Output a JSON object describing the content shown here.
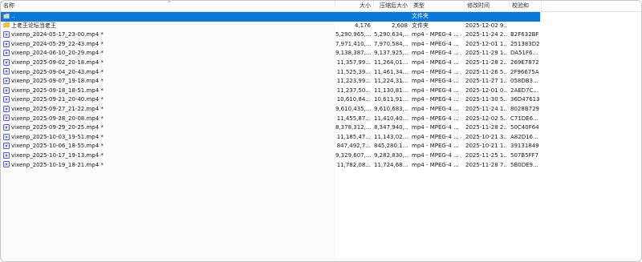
{
  "header": {
    "name": "名称",
    "size": "大小",
    "packed": "压缩后大小",
    "type": "类型",
    "modified": "修改时间",
    "crc": "校验和"
  },
  "rows": [
    {
      "name": "..",
      "size": "",
      "packed": "",
      "type": "文件夹",
      "modified": "",
      "crc": "",
      "icon": "parent-folder-icon",
      "selected": true
    },
    {
      "name": "上老王论坛当老王",
      "size": "4,176",
      "packed": "2,608",
      "type": "文件夹",
      "modified": "2025-12-02 9...",
      "crc": "",
      "icon": "folder-icon"
    },
    {
      "name": "vixenp_2024-05-17_23-00.mp4 *",
      "size": "5,290,965,...",
      "packed": "5,290,634,...",
      "type": "mp4 - MPEG-4 ...",
      "modified": "2025-11-24 2...",
      "crc": "B2F632BF",
      "icon": "video-file-icon"
    },
    {
      "name": "vixenp_2024-05-29_22-43.mp4 *",
      "size": "7,971,410,...",
      "packed": "7,970,584,...",
      "type": "mp4 - MPEG-4 ...",
      "modified": "2025-12-01 1...",
      "crc": "251383D2",
      "icon": "video-file-icon"
    },
    {
      "name": "vixenp_2024-06-10_20-29.mp4 *",
      "size": "9,138,387,...",
      "packed": "9,137,925,...",
      "type": "mp4 - MPEG-4 ...",
      "modified": "2025-11-29 1...",
      "crc": "DA51F6...",
      "icon": "video-file-icon"
    },
    {
      "name": "vixenp_2025-09-02_20-18.mp4 *",
      "size": "11,357,99...",
      "packed": "11,264,01...",
      "type": "mp4 - MPEG-4 ...",
      "modified": "2025-11-28 2...",
      "crc": "269E7872",
      "icon": "video-file-icon"
    },
    {
      "name": "vixenp_2025-09-04_20-43.mp4 *",
      "size": "11,525,39...",
      "packed": "11,461,34...",
      "type": "mp4 - MPEG-4 ...",
      "modified": "2025-11-26 5...",
      "crc": "2F96675A",
      "icon": "video-file-icon"
    },
    {
      "name": "vixenp_2025-09-07_19-18.mp4 *",
      "size": "11,223,99...",
      "packed": "11,224,31...",
      "type": "mp4 - MPEG-4 ...",
      "modified": "2025-11-27 1...",
      "crc": "058DB3...",
      "icon": "video-file-icon"
    },
    {
      "name": "vixenp_2025-09-18_18-51.mp4 *",
      "size": "11,237,50...",
      "packed": "11,130,81...",
      "type": "mp4 - MPEG-4 ...",
      "modified": "2025-12-01 0...",
      "crc": "2AED7C...",
      "icon": "video-file-icon"
    },
    {
      "name": "vixenp_2025-09-21_20-40.mp4 *",
      "size": "10,610,84...",
      "packed": "10,611,91...",
      "type": "mp4 - MPEG-4 ...",
      "modified": "2025-11-30 5...",
      "crc": "36D47613",
      "icon": "video-file-icon"
    },
    {
      "name": "vixenp_2025-09-27_21-22.mp4 *",
      "size": "9,610,435,...",
      "packed": "9,610,683,...",
      "type": "mp4 - MPEG-4 ...",
      "modified": "2025-11-24 1...",
      "crc": "8028B729",
      "icon": "video-file-icon"
    },
    {
      "name": "vixenp_2025-09-28_20-08.mp4 *",
      "size": "11,455,87...",
      "packed": "11,410,40...",
      "type": "mp4 - MPEG-4 ...",
      "modified": "2025-12-02 5...",
      "crc": "C71DE6...",
      "icon": "video-file-icon"
    },
    {
      "name": "vixenp_2025-09-29_20-25.mp4 *",
      "size": "8,378,312,...",
      "packed": "8,347,940,...",
      "type": "mp4 - MPEG-4 ...",
      "modified": "2025-11-28 2...",
      "crc": "50C40F64",
      "icon": "video-file-icon"
    },
    {
      "name": "vixenp_2025-10-03_19-51.mp4 *",
      "size": "11,185,47...",
      "packed": "11,143,02...",
      "type": "mp4 - MPEG-4 ...",
      "modified": "2025-10-21 3...",
      "crc": "A82D16...",
      "icon": "video-file-icon"
    },
    {
      "name": "vixenp_2025-10-06_18-55.mp4 *",
      "size": "847,492,7...",
      "packed": "845,280,1...",
      "type": "mp4 - MPEG-4 ...",
      "modified": "2025-10-21 1...",
      "crc": "39131849",
      "icon": "video-file-icon"
    },
    {
      "name": "vixenp_2025-10-17_19-13.mp4 *",
      "size": "9,329,607,...",
      "packed": "9,282,830,...",
      "type": "mp4 - MPEG-4 ...",
      "modified": "2025-11-25 1...",
      "crc": "507B5FF7",
      "icon": "video-file-icon"
    },
    {
      "name": "vixenp_2025-10-19_18-21.mp4 *",
      "size": "11,782,08...",
      "packed": "11,724,68...",
      "type": "mp4 - MPEG-4 ...",
      "modified": "2025-11-28 7...",
      "crc": "5B0DE9...",
      "icon": "video-file-icon"
    }
  ],
  "colors": {
    "selection": "#0a78d7",
    "folder": "#f3c14b",
    "video_icon": "#5b5bd6"
  },
  "icons": {
    "sort": "sort-caret-up-icon"
  }
}
